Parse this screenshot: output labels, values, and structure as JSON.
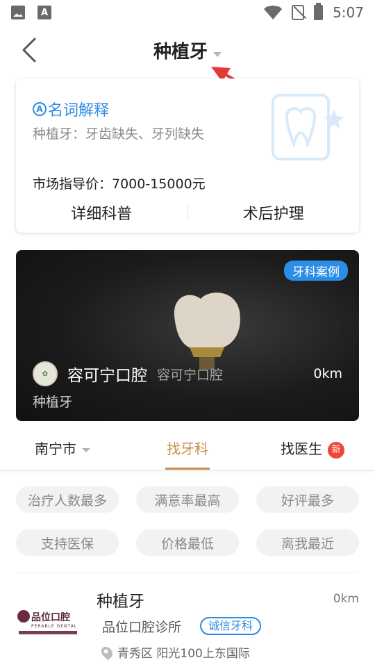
{
  "status_bar": {
    "time": "5:07",
    "icons": [
      "image-icon",
      "a-icon",
      "wifi-icon",
      "no-sim-icon",
      "battery-charging-icon"
    ]
  },
  "header": {
    "title": "种植牙"
  },
  "info_card": {
    "heading": "名词解释",
    "description": "种植牙：牙齿缺失、牙列缺失",
    "price": "市场指导价：7000-15000元",
    "actions": [
      "详细科普",
      "术后护理"
    ]
  },
  "case_card": {
    "tag": "牙科案例",
    "clinic_name": "容可宁口腔",
    "clinic_subname": "容可宁口腔",
    "distance": "0km",
    "procedure": "种植牙"
  },
  "tabs": [
    {
      "label": "南宁市",
      "has_caret": true
    },
    {
      "label": "找牙科",
      "active": true
    },
    {
      "label": "找医生",
      "badge": "新"
    }
  ],
  "filters": [
    "治疗人数最多",
    "满意率最高",
    "好评最多",
    "支持医保",
    "价格最低",
    "离我最近"
  ],
  "list": [
    {
      "title": "种植牙",
      "distance": "0km",
      "clinic": "品位口腔诊所",
      "badge": "诚信牙科",
      "address": "青秀区 阳光100上东国际",
      "logo_text": "品位口腔",
      "logo_sub": "PERABLE DENTAL"
    }
  ],
  "colors": {
    "accent_blue": "#2d8be3",
    "active_tab": "#c8904a",
    "badge_red": "#f0453a",
    "arrow_red": "#e53935"
  }
}
